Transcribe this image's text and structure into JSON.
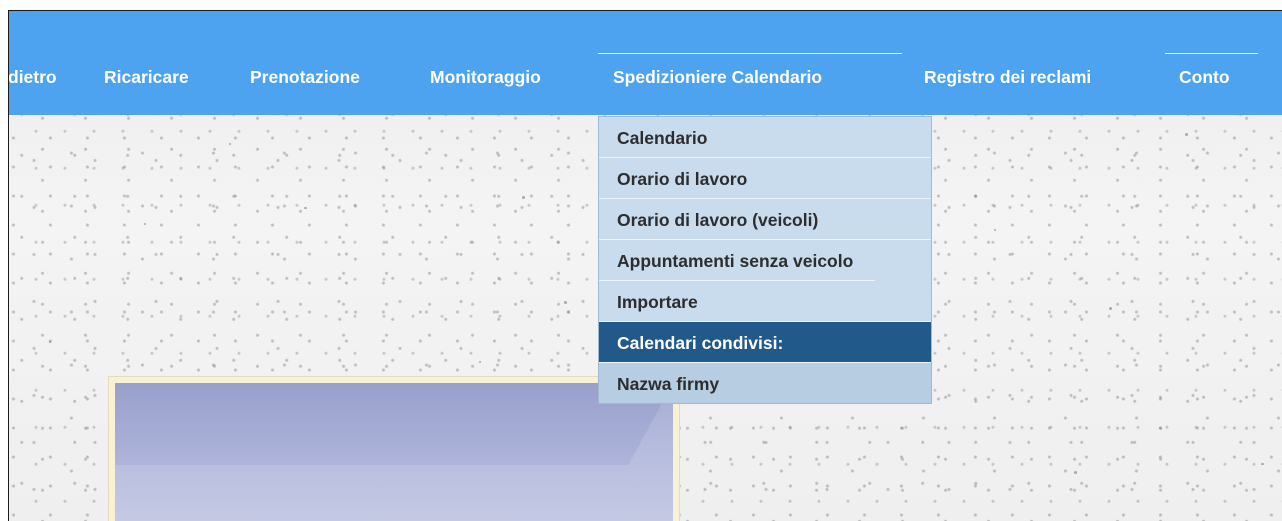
{
  "nav": {
    "items": [
      {
        "label": "dietro",
        "key": "back"
      },
      {
        "label": "Ricaricare",
        "key": "reload"
      },
      {
        "label": "Prenotazione",
        "key": "booking"
      },
      {
        "label": "Monitoraggio",
        "key": "monitoring"
      },
      {
        "label": "Spedizioniere Calendario",
        "key": "dispatcher-calendar"
      },
      {
        "label": "Registro dei reclami",
        "key": "complaints"
      },
      {
        "label": "Conto",
        "key": "account"
      }
    ],
    "background": "#4da3ef"
  },
  "dropdown": {
    "items": [
      {
        "label": "Calendario"
      },
      {
        "label": "Orario di lavoro"
      },
      {
        "label": "Orario di lavoro (veicoli)"
      },
      {
        "label": "Appuntamenti senza veicolo"
      },
      {
        "label": "Importare"
      }
    ],
    "shared_header": "Calendari condivisi:",
    "shared_items": [
      {
        "label": "Nazwa firmy"
      }
    ],
    "background": "#c9dcee",
    "header_color": "#21598b"
  }
}
